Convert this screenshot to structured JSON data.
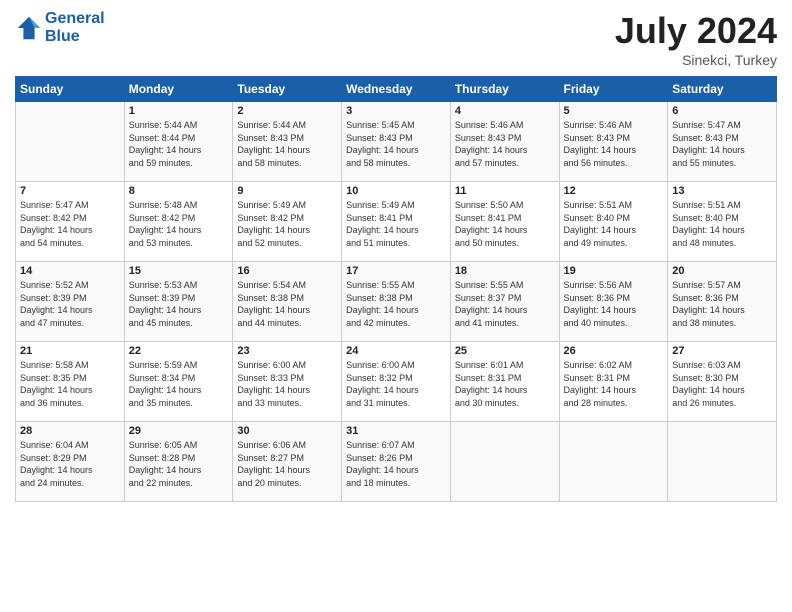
{
  "header": {
    "logo_line1": "General",
    "logo_line2": "Blue",
    "month": "July 2024",
    "location": "Sinekci, Turkey"
  },
  "days_of_week": [
    "Sunday",
    "Monday",
    "Tuesday",
    "Wednesday",
    "Thursday",
    "Friday",
    "Saturday"
  ],
  "weeks": [
    [
      {
        "day": "",
        "info": ""
      },
      {
        "day": "1",
        "info": "Sunrise: 5:44 AM\nSunset: 8:44 PM\nDaylight: 14 hours\nand 59 minutes."
      },
      {
        "day": "2",
        "info": "Sunrise: 5:44 AM\nSunset: 8:43 PM\nDaylight: 14 hours\nand 58 minutes."
      },
      {
        "day": "3",
        "info": "Sunrise: 5:45 AM\nSunset: 8:43 PM\nDaylight: 14 hours\nand 58 minutes."
      },
      {
        "day": "4",
        "info": "Sunrise: 5:46 AM\nSunset: 8:43 PM\nDaylight: 14 hours\nand 57 minutes."
      },
      {
        "day": "5",
        "info": "Sunrise: 5:46 AM\nSunset: 8:43 PM\nDaylight: 14 hours\nand 56 minutes."
      },
      {
        "day": "6",
        "info": "Sunrise: 5:47 AM\nSunset: 8:43 PM\nDaylight: 14 hours\nand 55 minutes."
      }
    ],
    [
      {
        "day": "7",
        "info": "Sunrise: 5:47 AM\nSunset: 8:42 PM\nDaylight: 14 hours\nand 54 minutes."
      },
      {
        "day": "8",
        "info": "Sunrise: 5:48 AM\nSunset: 8:42 PM\nDaylight: 14 hours\nand 53 minutes."
      },
      {
        "day": "9",
        "info": "Sunrise: 5:49 AM\nSunset: 8:42 PM\nDaylight: 14 hours\nand 52 minutes."
      },
      {
        "day": "10",
        "info": "Sunrise: 5:49 AM\nSunset: 8:41 PM\nDaylight: 14 hours\nand 51 minutes."
      },
      {
        "day": "11",
        "info": "Sunrise: 5:50 AM\nSunset: 8:41 PM\nDaylight: 14 hours\nand 50 minutes."
      },
      {
        "day": "12",
        "info": "Sunrise: 5:51 AM\nSunset: 8:40 PM\nDaylight: 14 hours\nand 49 minutes."
      },
      {
        "day": "13",
        "info": "Sunrise: 5:51 AM\nSunset: 8:40 PM\nDaylight: 14 hours\nand 48 minutes."
      }
    ],
    [
      {
        "day": "14",
        "info": "Sunrise: 5:52 AM\nSunset: 8:39 PM\nDaylight: 14 hours\nand 47 minutes."
      },
      {
        "day": "15",
        "info": "Sunrise: 5:53 AM\nSunset: 8:39 PM\nDaylight: 14 hours\nand 45 minutes."
      },
      {
        "day": "16",
        "info": "Sunrise: 5:54 AM\nSunset: 8:38 PM\nDaylight: 14 hours\nand 44 minutes."
      },
      {
        "day": "17",
        "info": "Sunrise: 5:55 AM\nSunset: 8:38 PM\nDaylight: 14 hours\nand 42 minutes."
      },
      {
        "day": "18",
        "info": "Sunrise: 5:55 AM\nSunset: 8:37 PM\nDaylight: 14 hours\nand 41 minutes."
      },
      {
        "day": "19",
        "info": "Sunrise: 5:56 AM\nSunset: 8:36 PM\nDaylight: 14 hours\nand 40 minutes."
      },
      {
        "day": "20",
        "info": "Sunrise: 5:57 AM\nSunset: 8:36 PM\nDaylight: 14 hours\nand 38 minutes."
      }
    ],
    [
      {
        "day": "21",
        "info": "Sunrise: 5:58 AM\nSunset: 8:35 PM\nDaylight: 14 hours\nand 36 minutes."
      },
      {
        "day": "22",
        "info": "Sunrise: 5:59 AM\nSunset: 8:34 PM\nDaylight: 14 hours\nand 35 minutes."
      },
      {
        "day": "23",
        "info": "Sunrise: 6:00 AM\nSunset: 8:33 PM\nDaylight: 14 hours\nand 33 minutes."
      },
      {
        "day": "24",
        "info": "Sunrise: 6:00 AM\nSunset: 8:32 PM\nDaylight: 14 hours\nand 31 minutes."
      },
      {
        "day": "25",
        "info": "Sunrise: 6:01 AM\nSunset: 8:31 PM\nDaylight: 14 hours\nand 30 minutes."
      },
      {
        "day": "26",
        "info": "Sunrise: 6:02 AM\nSunset: 8:31 PM\nDaylight: 14 hours\nand 28 minutes."
      },
      {
        "day": "27",
        "info": "Sunrise: 6:03 AM\nSunset: 8:30 PM\nDaylight: 14 hours\nand 26 minutes."
      }
    ],
    [
      {
        "day": "28",
        "info": "Sunrise: 6:04 AM\nSunset: 8:29 PM\nDaylight: 14 hours\nand 24 minutes."
      },
      {
        "day": "29",
        "info": "Sunrise: 6:05 AM\nSunset: 8:28 PM\nDaylight: 14 hours\nand 22 minutes."
      },
      {
        "day": "30",
        "info": "Sunrise: 6:06 AM\nSunset: 8:27 PM\nDaylight: 14 hours\nand 20 minutes."
      },
      {
        "day": "31",
        "info": "Sunrise: 6:07 AM\nSunset: 8:26 PM\nDaylight: 14 hours\nand 18 minutes."
      },
      {
        "day": "",
        "info": ""
      },
      {
        "day": "",
        "info": ""
      },
      {
        "day": "",
        "info": ""
      }
    ]
  ]
}
